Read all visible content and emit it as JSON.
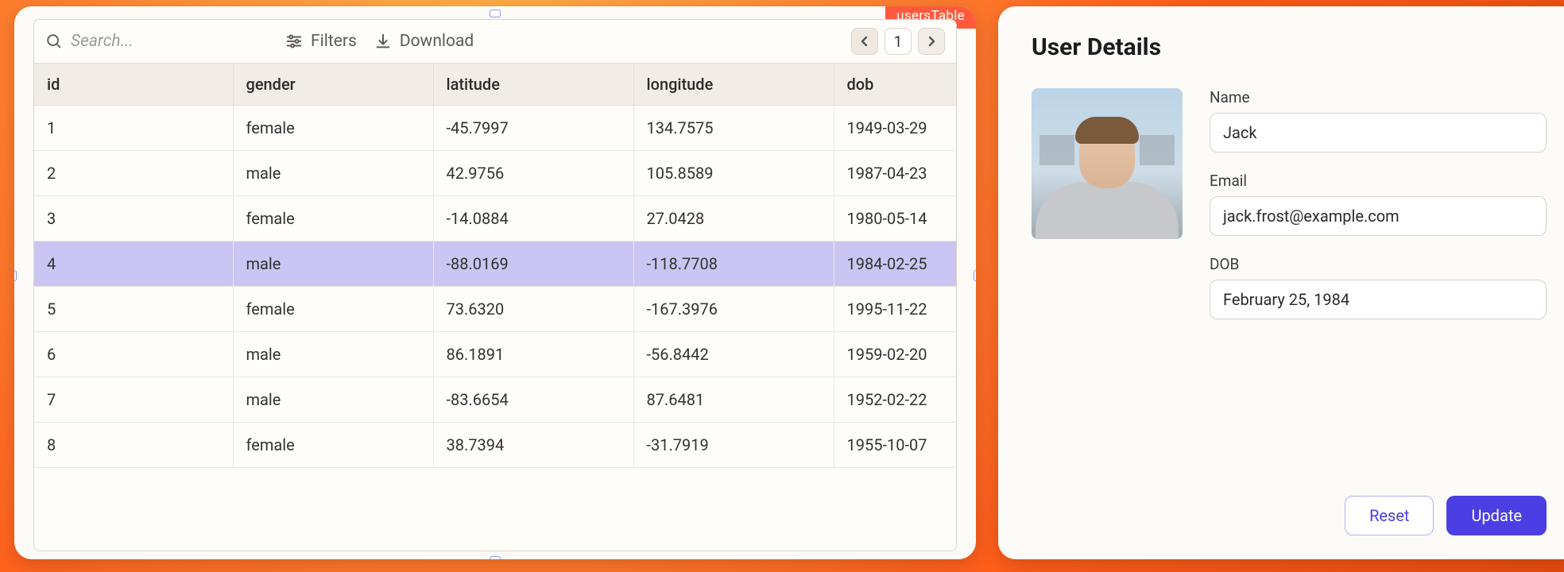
{
  "tag": "usersTable",
  "toolbar": {
    "search_placeholder": "Search...",
    "filters_label": "Filters",
    "download_label": "Download",
    "page": "1"
  },
  "columns": [
    "id",
    "gender",
    "latitude",
    "longitude",
    "dob"
  ],
  "rows": [
    {
      "id": "1",
      "gender": "female",
      "latitude": "-45.7997",
      "longitude": "134.7575",
      "dob": "1949-03-29"
    },
    {
      "id": "2",
      "gender": "male",
      "latitude": "42.9756",
      "longitude": "105.8589",
      "dob": "1987-04-23"
    },
    {
      "id": "3",
      "gender": "female",
      "latitude": "-14.0884",
      "longitude": "27.0428",
      "dob": "1980-05-14"
    },
    {
      "id": "4",
      "gender": "male",
      "latitude": "-88.0169",
      "longitude": "-118.7708",
      "dob": "1984-02-25"
    },
    {
      "id": "5",
      "gender": "female",
      "latitude": "73.6320",
      "longitude": "-167.3976",
      "dob": "1995-11-22"
    },
    {
      "id": "6",
      "gender": "male",
      "latitude": "86.1891",
      "longitude": "-56.8442",
      "dob": "1959-02-20"
    },
    {
      "id": "7",
      "gender": "male",
      "latitude": "-83.6654",
      "longitude": "87.6481",
      "dob": "1952-02-22"
    },
    {
      "id": "8",
      "gender": "female",
      "latitude": "38.7394",
      "longitude": "-31.7919",
      "dob": "1955-10-07"
    }
  ],
  "selected_row_index": 3,
  "details": {
    "title": "User Details",
    "name_label": "Name",
    "name_value": "Jack",
    "email_label": "Email",
    "email_value": "jack.frost@example.com",
    "dob_label": "DOB",
    "dob_value": "February 25, 1984",
    "reset_label": "Reset",
    "update_label": "Update"
  }
}
